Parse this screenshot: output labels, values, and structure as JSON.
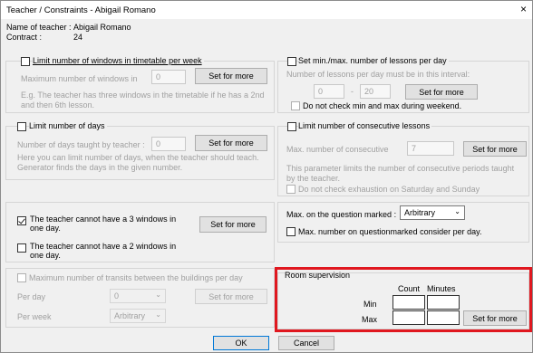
{
  "window": {
    "title": "Teacher / Constraints - Abigail Romano",
    "close_glyph": "×"
  },
  "header": {
    "name_label": "Name of teacher :",
    "name_value": "Abigail Romano",
    "contract_label": "Contract :",
    "contract_value": "24"
  },
  "windows_per_week": {
    "checkbox_label": "Limit number of windows in timetable per week",
    "max_label": "Maximum number of windows in",
    "max_value": "0",
    "set_button": "Set for more",
    "hint": "E.g. The teacher has three windows in the timetable if he has a 2nd and then 6th lesson."
  },
  "lessons_per_day": {
    "checkbox_label": "Set min./max. number of lessons per day",
    "interval_label": "Number of lessons per day must be in this interval:",
    "min_value": "0",
    "dash": "-",
    "max_value": "20",
    "set_button": "Set for more",
    "weekend_label": "Do not check min and max during weekend."
  },
  "days": {
    "checkbox_label": "Limit number of days",
    "taught_label": "Number of days taught by teacher :",
    "taught_value": "0",
    "set_button": "Set for more",
    "hint": "Here you can limit number of days, when the teacher should teach. Generator finds the days in the given number."
  },
  "consecutive": {
    "checkbox_label": "Limit number of consecutive lessons",
    "max_label": "Max. number of consecutive",
    "max_value": "7",
    "set_button": "Set for more",
    "hint": "This parameter limits the number of consecutive periods taught by the teacher.",
    "weekend_label": "Do not check exhaustion on Saturday and Sunday"
  },
  "windows_day": {
    "three_label": "The teacher cannot have a 3 windows in one day.",
    "two_label": "The teacher cannot have a 2 windows in one day.",
    "set_button": "Set for more"
  },
  "question_marked": {
    "label": "Max. on the question marked :",
    "select_value": "Arbitrary",
    "per_day_label": "Max. number on questionmarked consider per day."
  },
  "transits": {
    "checkbox_label": "Maximum number of transits between the buildings per day",
    "per_day_label": "Per day",
    "per_day_value": "0",
    "per_week_label": "Per week",
    "per_week_value": "Arbitrary",
    "set_button": "Set for more"
  },
  "room_supervision": {
    "title": "Room supervision",
    "count_header": "Count",
    "minutes_header": "Minutes",
    "min_label": "Min",
    "max_label": "Max",
    "set_button": "Set for more",
    "highlight_color": "#e0171f"
  },
  "footer": {
    "ok": "OK",
    "cancel": "Cancel"
  }
}
